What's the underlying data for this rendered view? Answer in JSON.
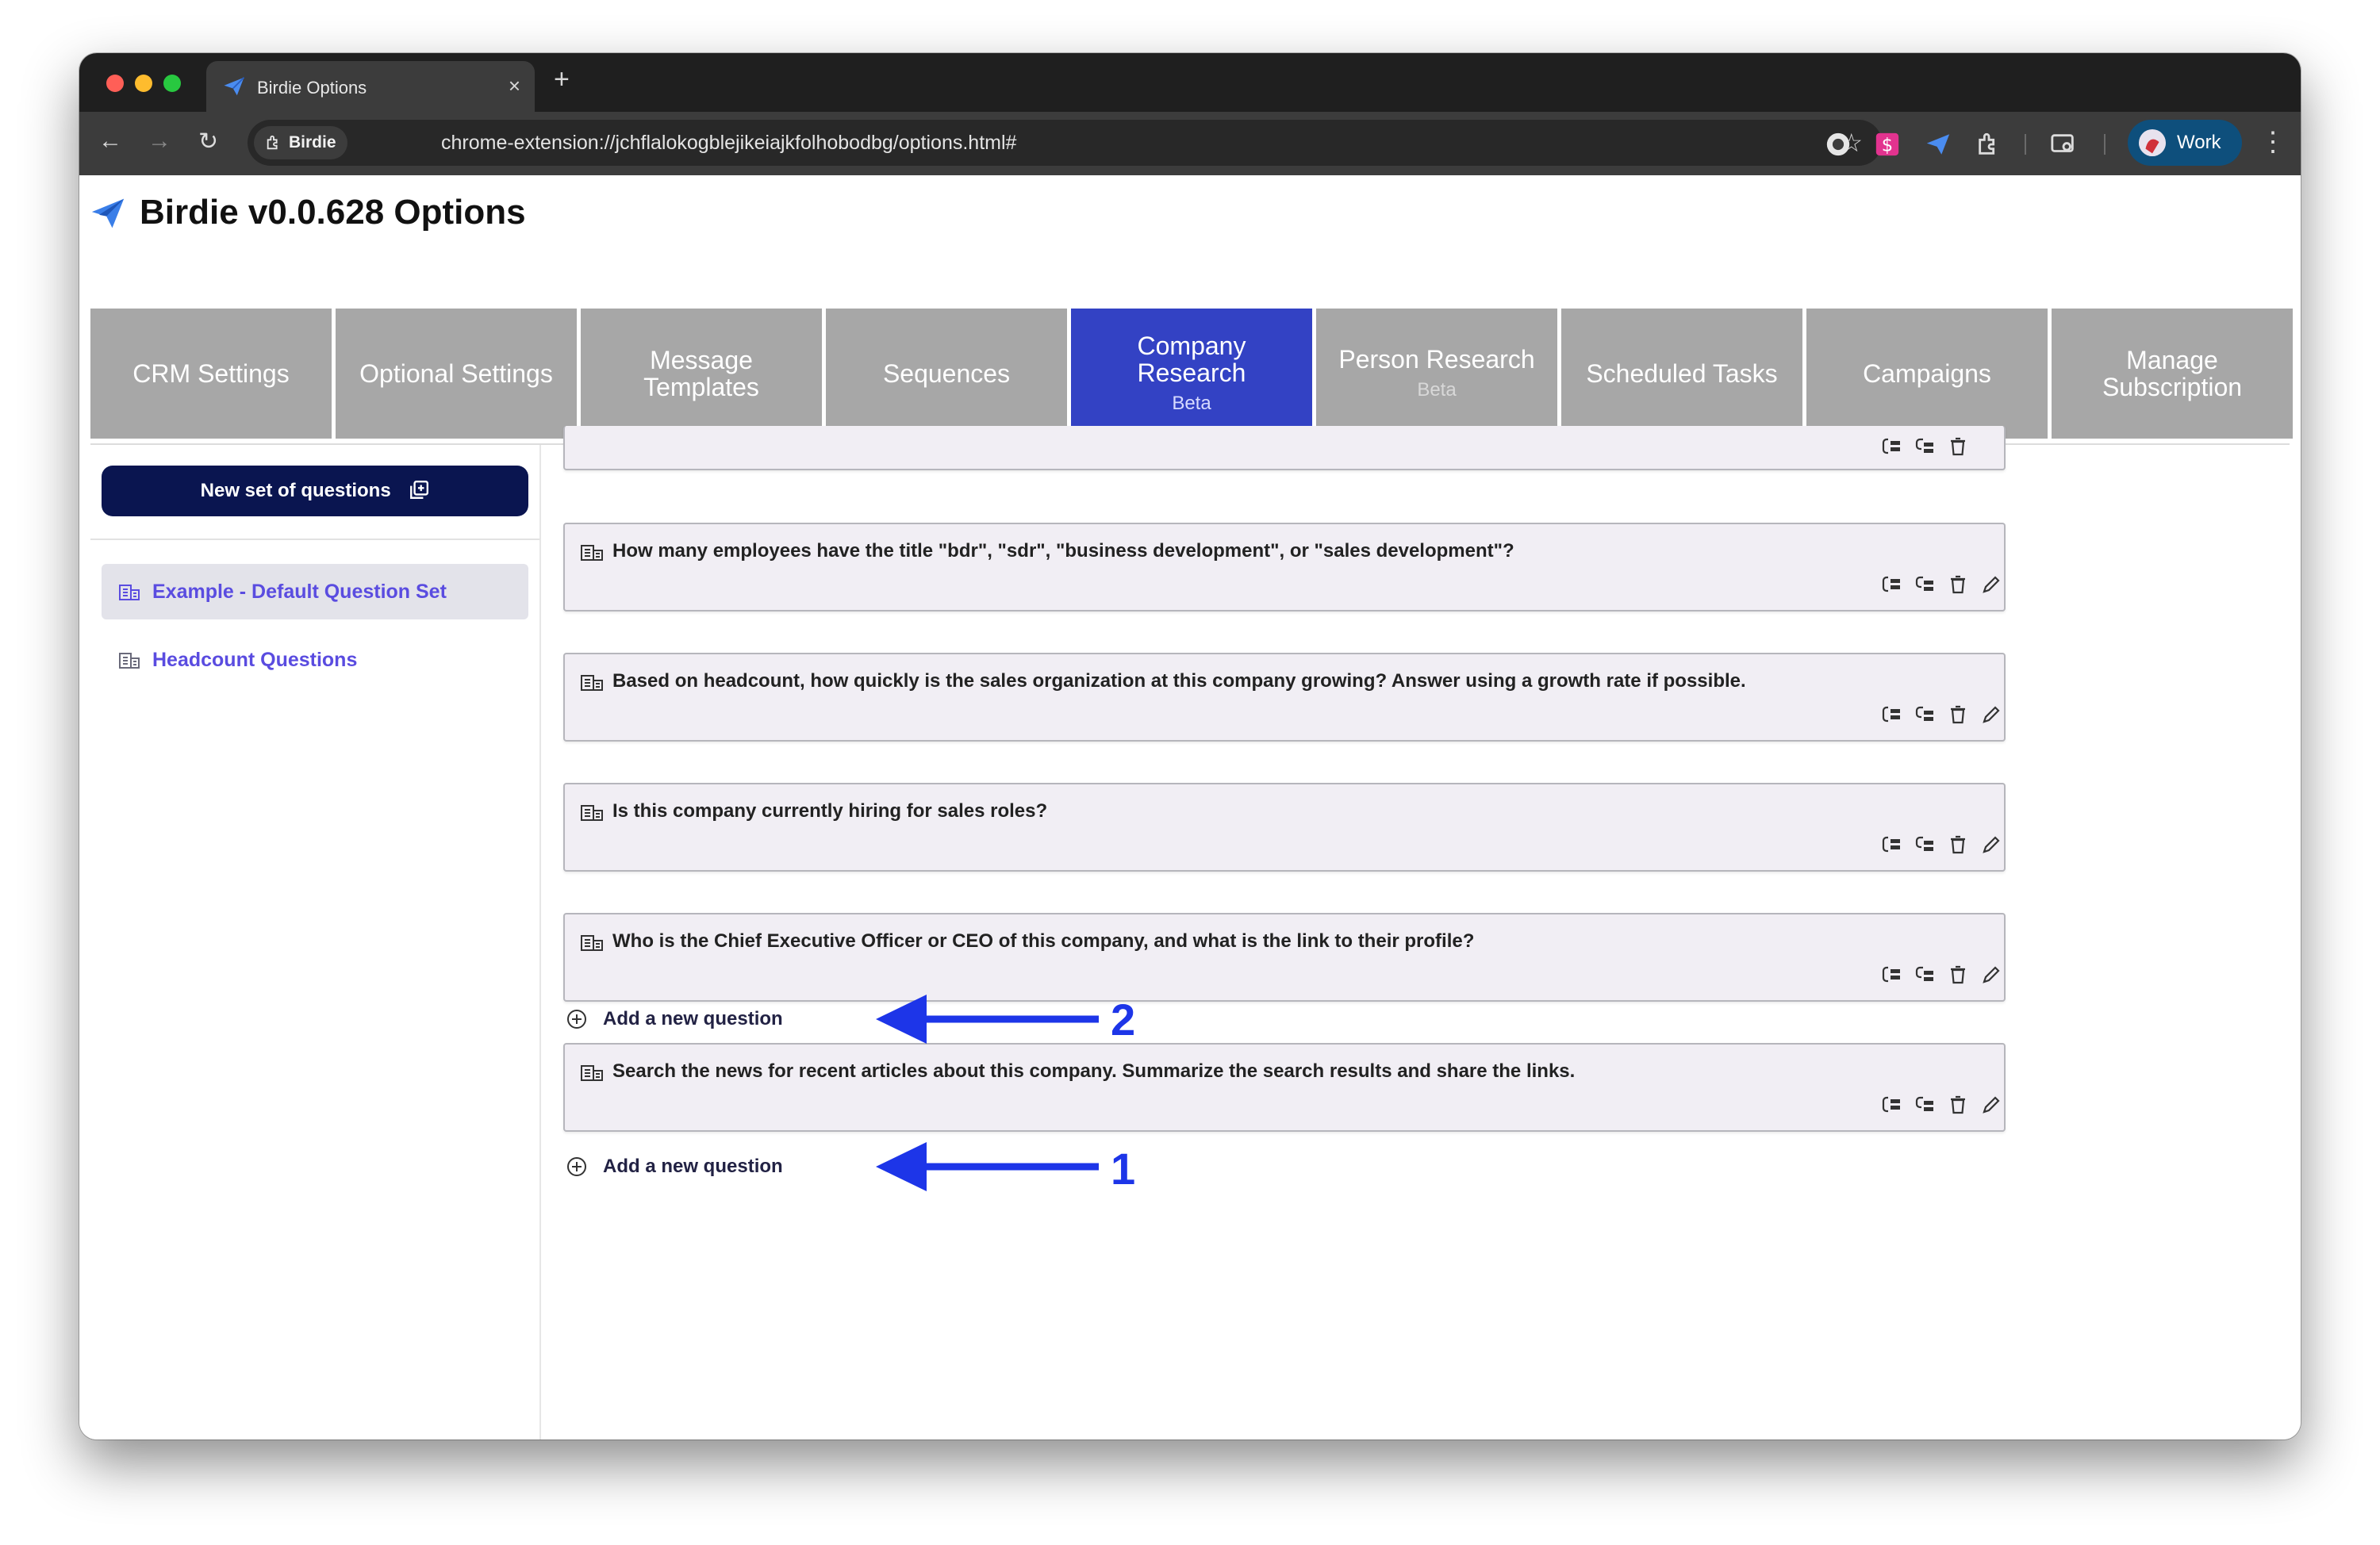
{
  "browser": {
    "tab_title": "Birdie Options",
    "site_chip": "Birdie",
    "url": "chrome-extension://jchflalokogblejikeiajkfolhobodbg/options.html#",
    "profile_label": "Work"
  },
  "app": {
    "title": "Birdie v0.0.628 Options",
    "brand_color": "#3342c4"
  },
  "nav_tabs": [
    {
      "label": "CRM Settings",
      "sub": ""
    },
    {
      "label": "Optional Settings",
      "sub": ""
    },
    {
      "label": "Message Templates",
      "sub": ""
    },
    {
      "label": "Sequences",
      "sub": ""
    },
    {
      "label": "Company Research",
      "sub": "Beta",
      "active": true
    },
    {
      "label": "Person Research",
      "sub": "Beta"
    },
    {
      "label": "Scheduled Tasks",
      "sub": ""
    },
    {
      "label": "Campaigns",
      "sub": ""
    },
    {
      "label": "Manage Subscription",
      "sub": ""
    }
  ],
  "sidebar": {
    "new_set_label": "New set of questions",
    "items": [
      {
        "label": "Example - Default Question Set",
        "selected": true
      },
      {
        "label": "Headcount Questions",
        "selected": false
      }
    ]
  },
  "questions": [
    {
      "text": ""
    },
    {
      "text": "How many employees have the title \"bdr\", \"sdr\", \"business development\", or \"sales development\"?"
    },
    {
      "text": "Based on headcount, how quickly is the sales organization at this company growing? Answer using a growth rate if possible."
    },
    {
      "text": "Is this company currently hiring for sales roles?"
    },
    {
      "text": "Who is the Chief Executive Officer or CEO of this company, and what is the link to their profile?"
    },
    {
      "text": "Search the news for recent articles about this company. Summarize the search results and share the links."
    }
  ],
  "add_question_label": "Add a new question",
  "annotations": {
    "arrow_color": "#1d35e8",
    "upper_number": "2",
    "lower_number": "1"
  }
}
